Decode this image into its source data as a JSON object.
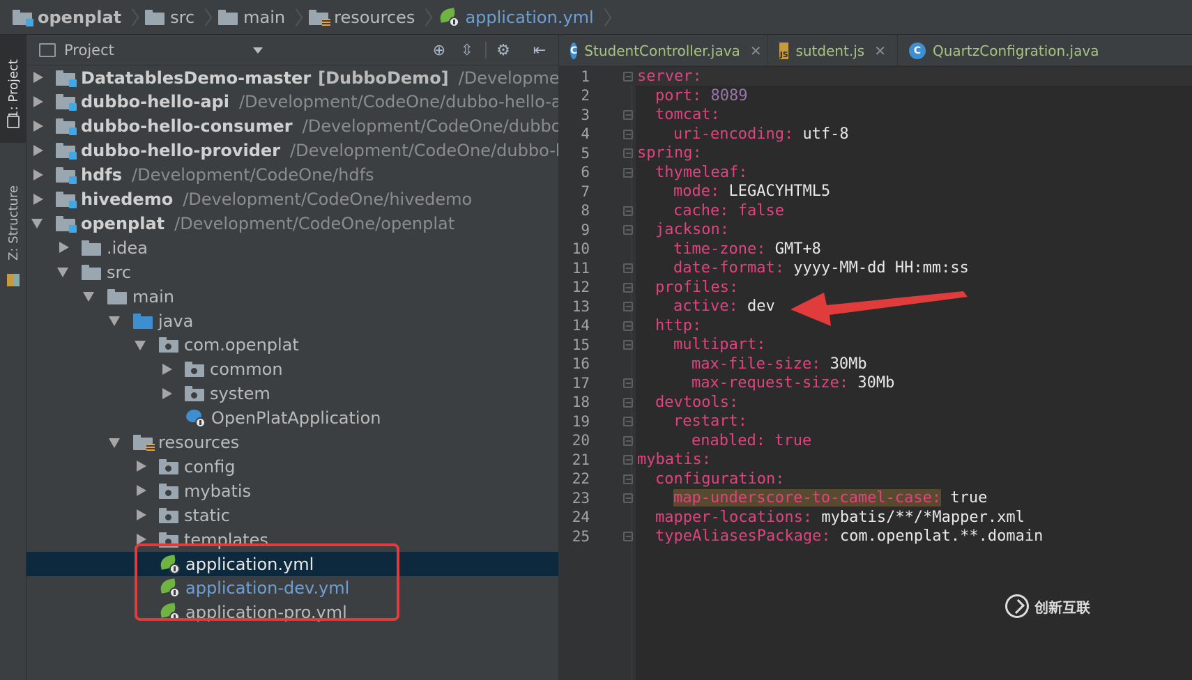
{
  "breadcrumb": [
    {
      "label": "openplat",
      "icon": "module-folder-icon"
    },
    {
      "label": "src",
      "icon": "folder-icon"
    },
    {
      "label": "main",
      "icon": "folder-icon"
    },
    {
      "label": "resources",
      "icon": "resources-folder-icon"
    },
    {
      "label": "application.yml",
      "icon": "spring-config-icon"
    }
  ],
  "tool_strip": {
    "project_label": "1: Project",
    "structure_label": "Z: Structure"
  },
  "project_panel": {
    "title": "Project"
  },
  "tree": [
    {
      "name": "DatatablesDemo-master",
      "tag": "[DubboDemo]",
      "path": "/Development/CodeO",
      "arrow": "right",
      "depth": 0,
      "icon": "module"
    },
    {
      "name": "dubbo-hello-api",
      "path": "/Development/CodeOne/dubbo-hello-api",
      "arrow": "right",
      "depth": 0,
      "icon": "module"
    },
    {
      "name": "dubbo-hello-consumer",
      "path": "/Development/CodeOne/dubbo-hell",
      "arrow": "right",
      "depth": 0,
      "icon": "module"
    },
    {
      "name": "dubbo-hello-provider",
      "path": "/Development/CodeOne/dubbo-hello-",
      "arrow": "right",
      "depth": 0,
      "icon": "module"
    },
    {
      "name": "hdfs",
      "path": "/Development/CodeOne/hdfs",
      "arrow": "right",
      "depth": 0,
      "icon": "module"
    },
    {
      "name": "hivedemo",
      "path": "/Development/CodeOne/hivedemo",
      "arrow": "right",
      "depth": 0,
      "icon": "module"
    },
    {
      "name": "openplat",
      "path": "/Development/CodeOne/openplat",
      "arrow": "down",
      "depth": 0,
      "icon": "module"
    },
    {
      "name": ".idea",
      "arrow": "right",
      "depth": 1,
      "icon": "folder"
    },
    {
      "name": "src",
      "arrow": "down",
      "depth": 1,
      "icon": "folder"
    },
    {
      "name": "main",
      "arrow": "down",
      "depth": 2,
      "icon": "folder"
    },
    {
      "name": "java",
      "arrow": "down",
      "depth": 3,
      "icon": "blue"
    },
    {
      "name": "com.openplat",
      "arrow": "down",
      "depth": 4,
      "icon": "pkg"
    },
    {
      "name": "common",
      "arrow": "right",
      "depth": 5,
      "icon": "pkg"
    },
    {
      "name": "system",
      "arrow": "right",
      "depth": 5,
      "icon": "pkg"
    },
    {
      "name": "OpenPlatApplication",
      "arrow": "none",
      "depth": 5,
      "icon": "spring-app"
    },
    {
      "name": "resources",
      "arrow": "down",
      "depth": 3,
      "icon": "res"
    },
    {
      "name": "config",
      "arrow": "right",
      "depth": 4,
      "icon": "pkg"
    },
    {
      "name": "mybatis",
      "arrow": "right",
      "depth": 4,
      "icon": "pkg"
    },
    {
      "name": "static",
      "arrow": "right",
      "depth": 4,
      "icon": "pkg"
    },
    {
      "name": "templates",
      "arrow": "right",
      "depth": 4,
      "icon": "pkg"
    },
    {
      "name": "application.yml",
      "arrow": "none",
      "depth": 4,
      "icon": "spring",
      "selected": true
    },
    {
      "name": "application-dev.yml",
      "arrow": "none",
      "depth": 4,
      "icon": "spring",
      "blue": true
    },
    {
      "name": "application-pro.yml",
      "arrow": "none",
      "depth": 4,
      "icon": "spring"
    }
  ],
  "tabs": [
    {
      "label": "StudentController.java",
      "icon": "java-class-icon",
      "badge": "C"
    },
    {
      "label": "sutdent.js",
      "icon": "js-file-icon",
      "badge": "JS"
    },
    {
      "label": "QuartzConfigration.java",
      "icon": "java-class-icon",
      "badge": "C"
    }
  ],
  "code": [
    {
      "n": "1",
      "indent": 0,
      "key": "server:",
      "val": ""
    },
    {
      "n": "2",
      "indent": 1,
      "key": "port:",
      "val": "8089",
      "vtype": "num"
    },
    {
      "n": "3",
      "indent": 1,
      "key": "tomcat:",
      "val": ""
    },
    {
      "n": "4",
      "indent": 2,
      "key": "uri-encoding:",
      "val": "utf-8"
    },
    {
      "n": "5",
      "indent": 0,
      "key": "spring:",
      "val": ""
    },
    {
      "n": "6",
      "indent": 1,
      "key": "thymeleaf:",
      "val": ""
    },
    {
      "n": "7",
      "indent": 2,
      "key": "mode:",
      "val": "LEGACYHTML5"
    },
    {
      "n": "8",
      "indent": 2,
      "key": "cache:",
      "val": "false",
      "vtype": "kw"
    },
    {
      "n": "9",
      "indent": 1,
      "key": "jackson:",
      "val": ""
    },
    {
      "n": "10",
      "indent": 2,
      "key": "time-zone:",
      "val": "GMT+8"
    },
    {
      "n": "11",
      "indent": 2,
      "key": "date-format:",
      "val": "yyyy-MM-dd HH:mm:ss"
    },
    {
      "n": "12",
      "indent": 1,
      "key": "profiles:",
      "val": ""
    },
    {
      "n": "13",
      "indent": 2,
      "key": "active:",
      "val": "dev"
    },
    {
      "n": "14",
      "indent": 1,
      "key": "http:",
      "val": ""
    },
    {
      "n": "15",
      "indent": 2,
      "key": "multipart:",
      "val": ""
    },
    {
      "n": "16",
      "indent": 3,
      "key": "max-file-size:",
      "val": "30Mb"
    },
    {
      "n": "17",
      "indent": 3,
      "key": "max-request-size:",
      "val": "30Mb"
    },
    {
      "n": "18",
      "indent": 1,
      "key": "devtools:",
      "val": ""
    },
    {
      "n": "19",
      "indent": 2,
      "key": "restart:",
      "val": ""
    },
    {
      "n": "20",
      "indent": 3,
      "key": "enabled:",
      "val": "true",
      "vtype": "kw"
    },
    {
      "n": "21",
      "indent": 0,
      "key": "mybatis:",
      "val": ""
    },
    {
      "n": "22",
      "indent": 1,
      "key": "configuration:",
      "val": ""
    },
    {
      "n": "23",
      "indent": 2,
      "key": "map-underscore-to-camel-case:",
      "val": "true",
      "highlight": true
    },
    {
      "n": "24",
      "indent": 1,
      "key": "mapper-locations:",
      "val": "mybatis/**/*Mapper.xml"
    },
    {
      "n": "25",
      "indent": 1,
      "key": "typeAliasesPackage:",
      "val": "com.openplat.**.domain"
    }
  ],
  "watermark": {
    "text": "创新互联"
  },
  "colors": {
    "yaml_key": "#e0437e",
    "yaml_number": "#9876aa",
    "annotation_red": "#e03c3c",
    "selection": "#0d293e"
  }
}
